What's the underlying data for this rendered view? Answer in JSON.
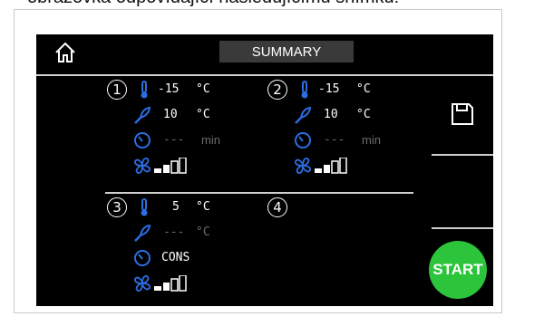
{
  "caption": "obrazovka odpovídající následujícímu snímku:",
  "header": {
    "title": "SUMMARY",
    "home_icon": "home-icon"
  },
  "zones": [
    {
      "number": "1",
      "temp": "-15",
      "temp_unit": "°C",
      "probe": "10",
      "probe_unit": "°C",
      "time": "---",
      "time_unit": "min",
      "fan_level": 2,
      "fan_max": 4
    },
    {
      "number": "2",
      "temp": "-15",
      "temp_unit": "°C",
      "probe": "10",
      "probe_unit": "°C",
      "time": "---",
      "time_unit": "min",
      "fan_level": 2,
      "fan_max": 4
    },
    {
      "number": "3",
      "temp": "5",
      "temp_unit": "°C",
      "probe": "---",
      "probe_unit": "°C",
      "time": "CONS",
      "fan_level": 2,
      "fan_max": 4
    },
    {
      "number": "4"
    }
  ],
  "sidebar": {
    "save_icon": "save-icon",
    "start_label": "START"
  },
  "colors": {
    "accent_blue": "#2b6de3",
    "start_green": "#2bc43a",
    "screen_bg": "#000000"
  }
}
